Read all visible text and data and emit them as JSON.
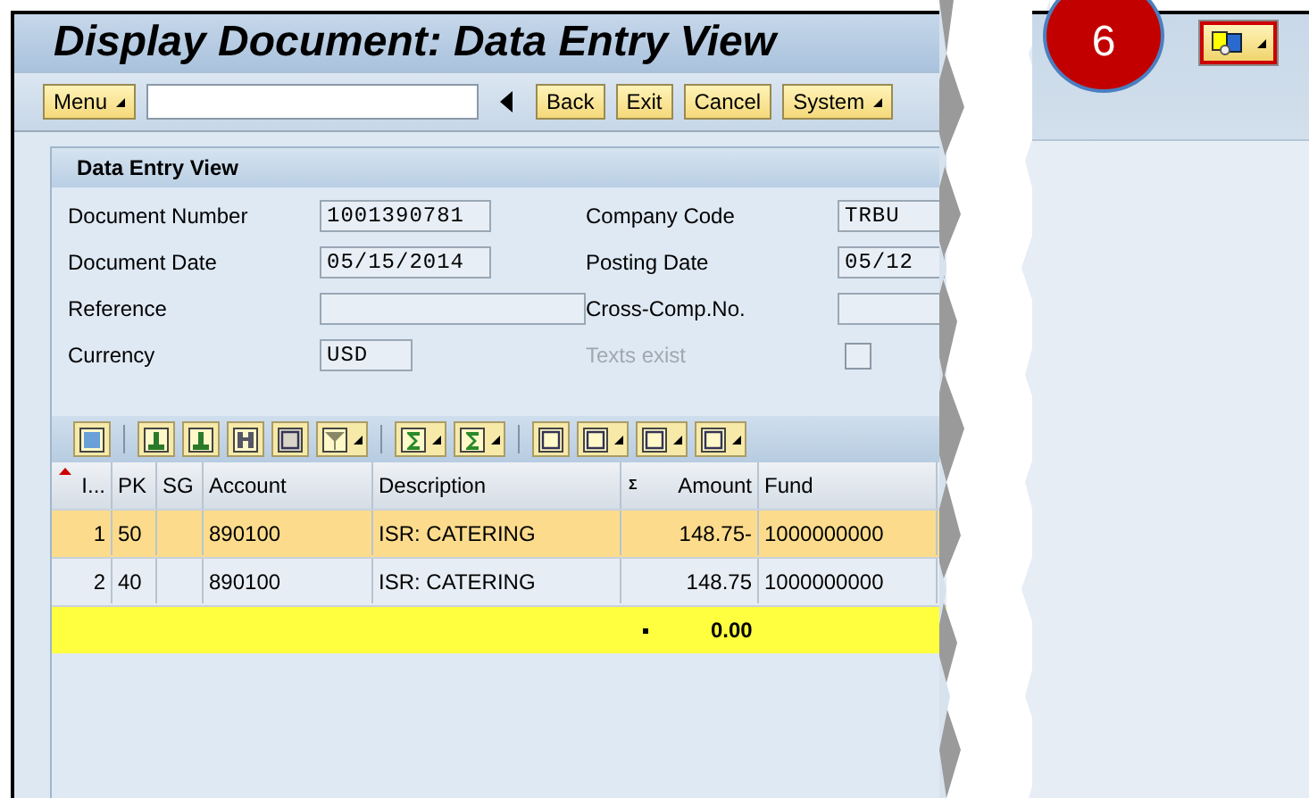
{
  "window": {
    "title": "Display Document: Data Entry View"
  },
  "toolbar": {
    "buttons": [
      {
        "label": "Menu",
        "kind": "dropdown"
      }
    ],
    "nav_buttons": [
      {
        "label": "Back",
        "kind": "plain"
      },
      {
        "label": "Exit",
        "kind": "plain"
      },
      {
        "label": "Cancel",
        "kind": "plain"
      },
      {
        "label": "System",
        "kind": "dropdown"
      }
    ]
  },
  "step_marker": {
    "label": "6"
  },
  "group": {
    "title": "Data Entry View",
    "left_fields": [
      {
        "label": "Document Number",
        "value": "1001390781"
      },
      {
        "label": "Document Date",
        "value": "05/15/2014"
      },
      {
        "label": "Reference"
      },
      {
        "label": "Currency",
        "value": "USD"
      }
    ],
    "right_fields": [
      {
        "label": "Company Code",
        "value": "TRBU",
        "kind": "field",
        "disabled": false
      },
      {
        "label": "Posting Date",
        "value": "05/12",
        "kind": "field",
        "disabled": false
      },
      {
        "label": "Cross-Comp.No.",
        "kind": "field",
        "disabled": false
      },
      {
        "label": "Texts exist",
        "kind": "checkbox",
        "disabled": true,
        "checked": false
      }
    ]
  },
  "table": {
    "columns": [
      {
        "label": "I...",
        "sorted": true
      },
      {
        "label": "PK",
        "sorted": false
      },
      {
        "label": "SG",
        "sorted": false
      },
      {
        "label": "Account",
        "sorted": false
      },
      {
        "label": "Description",
        "sorted": false
      },
      {
        "label": "Amount",
        "sorted": false,
        "marker": "Σ"
      },
      {
        "label": "Fund",
        "sorted": false
      }
    ],
    "rows": [
      {
        "selected": true,
        "cells": [
          "1",
          "50",
          "",
          "890100",
          "ISR: CATERING",
          "148.75-",
          "1000000000"
        ]
      },
      {
        "selected": false,
        "cells": [
          "2",
          "40",
          "",
          "890100",
          "ISR: CATERING",
          "148.75",
          "1000000000"
        ]
      }
    ],
    "total": "0.00"
  }
}
